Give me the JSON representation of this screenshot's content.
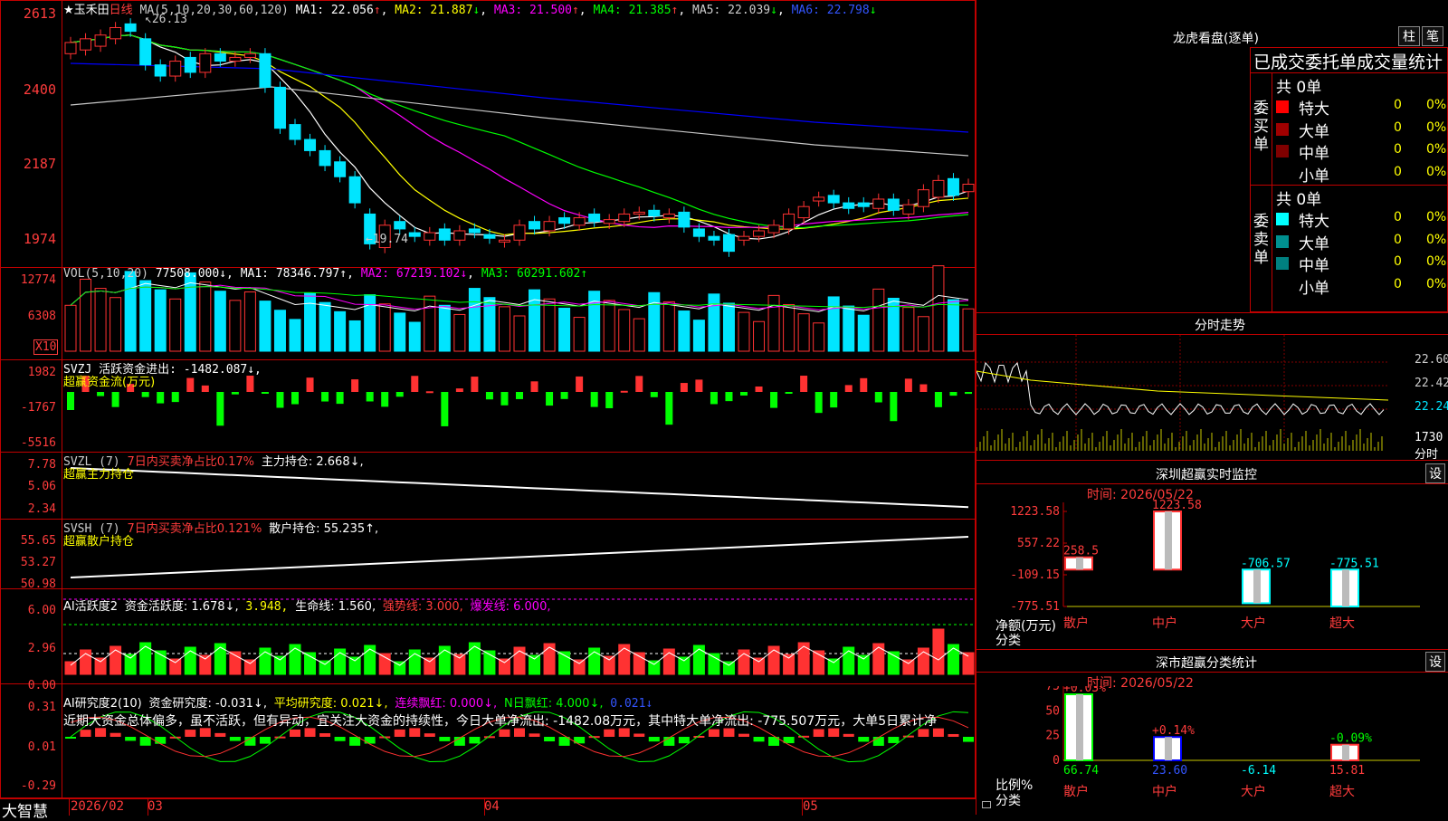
{
  "stock": {
    "name": "玉禾田",
    "period": "日线",
    "star": "★"
  },
  "colors": {
    "up": "#ff3232",
    "down": "#00e5ff",
    "grid": "#c00000",
    "ma1": "#ffffff",
    "ma2": "#ffff00",
    "ma3": "#ff00ff",
    "ma4": "#00ff00",
    "ma5": "#c8c8c8",
    "ma6": "#0000ff"
  },
  "main": {
    "ma_label": "MA(5,10,20,30,60,120)",
    "ma1": "MA1: 22.056",
    "ma2": "MA2: 21.887",
    "ma3": "MA3: 21.500",
    "ma4": "MA4: 21.385",
    "ma5": "MA5: 22.039",
    "ma6": "MA6: 22.798",
    "arrow_up": "↑",
    "arrow_down": "↓",
    "yticks": [
      "2613",
      "2400",
      "2187",
      "1974"
    ],
    "high_mark": "26.13",
    "low_mark": "←19.74"
  },
  "vol": {
    "label": "VOL(5,10,20)",
    "value": "77508.000↓",
    "ma1": "MA1: 78346.797↑",
    "ma2": "MA2: 67219.102↓",
    "ma3": "MA3: 60291.602↑",
    "yticks": [
      "12774",
      "6308"
    ],
    "unit": "X10"
  },
  "svzj": {
    "label": "SVZJ  活跃资金进出: -1482.087↓,",
    "sub": "超赢资金流(万元)",
    "yticks": [
      "1982",
      "-1767",
      "-5516"
    ]
  },
  "svzl": {
    "label": "SVZL (7)",
    "label2": "7日内买卖净占比0.17%",
    "label3": "主力持仓: 2.668↓,",
    "sub": "超赢主力持仓",
    "yticks": [
      "7.78",
      "5.06",
      "2.34"
    ]
  },
  "svsh": {
    "label": "SVSH (7)",
    "label2": "7日内买卖净占比0.121%",
    "label3": "散户持仓: 55.235↑,",
    "sub": "超赢散户持仓",
    "yticks": [
      "55.65",
      "53.27",
      "50.98"
    ]
  },
  "ai1": {
    "label": "AI活跃度2",
    "v1": "资金活跃度: 1.678↓,",
    "v2": "3.948,",
    "v3": "生命线: 1.560,",
    "v4": "强势线: 3.000,",
    "v5": "爆发线: 6.000,",
    "yticks": [
      "6.00",
      "2.96",
      "0.00"
    ]
  },
  "ai2": {
    "label": "AI研究度2(10)",
    "v1": "资金研究度: -0.031↓,",
    "v2": "平均研究度: 0.021↓,",
    "v3": "连续飘红: 0.000↓,",
    "v4": "N日飘红: 4.000↓,",
    "v5": "0.021↓",
    "comment": "近期大资金总体偏多，虽不活跃，但有异动，宜关注大资金的持续性，今日大单净流出: -1482.08万元，其中特大单净流出: -775.507万元，大单5日累计净",
    "yticks": [
      "0.31",
      "0.01",
      "-0.29"
    ]
  },
  "xaxis": {
    "brand": "大智慧",
    "labels": [
      "2026/02",
      "03",
      "04",
      "05"
    ]
  },
  "right": {
    "longhu": {
      "title": "龙虎看盘(逐单)",
      "btn1": "柱",
      "btn2": "笔",
      "header": "已成交委托单成交量统计",
      "buy_label": "委买单",
      "sell_label": "委卖单",
      "buy_total": "共 0单",
      "sell_total": "共 0单",
      "buy_rows": [
        {
          "name": "特大",
          "count": "0",
          "pct": "0%"
        },
        {
          "name": "大单",
          "count": "0",
          "pct": "0%"
        },
        {
          "name": "中单",
          "count": "0",
          "pct": "0%"
        },
        {
          "name": "小单",
          "count": "0",
          "pct": "0%"
        }
      ],
      "sell_rows": [
        {
          "name": "特大",
          "count": "0",
          "pct": "0%"
        },
        {
          "name": "大单",
          "count": "0",
          "pct": "0%"
        },
        {
          "name": "中单",
          "count": "0",
          "pct": "0%"
        },
        {
          "name": "小单",
          "count": "0",
          "pct": "0%"
        }
      ]
    },
    "intraday": {
      "title": "分时走势",
      "yticks": [
        "22.60",
        "22.42",
        "22.24"
      ],
      "vol_tick": "1730",
      "vol_label": "分时"
    },
    "sz_monitor": {
      "title": "深圳超赢实时监控",
      "btn": "设",
      "time": "时间: 2026/05/22",
      "yticks": [
        "1223.58",
        "557.22",
        "-109.15",
        "-775.51"
      ],
      "ylabel": "净额(万元)",
      "xlabel": "分类",
      "categories": [
        "散户",
        "中户",
        "大户",
        "超大"
      ],
      "values": [
        258.5,
        1223.58,
        -706.57,
        -775.51
      ],
      "value_labels": [
        "258.5",
        "1223.58",
        "-706.57",
        "-775.51"
      ]
    },
    "sz_class": {
      "title": "深市超赢分类统计",
      "btn": "设",
      "time": "时间: 2026/05/22",
      "yticks": [
        "75",
        "50",
        "25",
        "0"
      ],
      "ylabel": "比例%",
      "xlabel": "分类",
      "categories": [
        "散户",
        "中户",
        "大户",
        "超大"
      ],
      "values": [
        66.74,
        23.6,
        -6.14,
        15.81
      ],
      "value_labels": [
        "66.74",
        "23.60",
        "-6.14",
        "15.81"
      ],
      "changes": [
        "+0.03%",
        "+0.14%",
        "",
        "-0.09%"
      ]
    }
  }
}
